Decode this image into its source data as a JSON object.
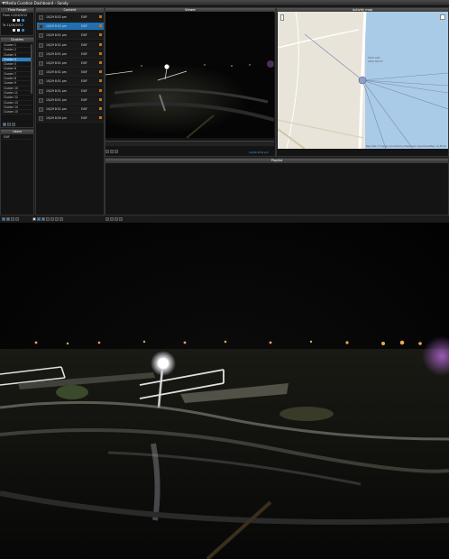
{
  "window": {
    "title": "Media Curation Dashboard - Sandy"
  },
  "time_range": {
    "title": "Time Range",
    "from_label": "From",
    "from_value": "11/04/2012",
    "to_label": "To",
    "to_value": "11/04/2012"
  },
  "clusters": {
    "title": "Clusters",
    "items": [
      "Cluster 1",
      "Cluster 2",
      "Cluster 3",
      "Cluster 4",
      "Cluster 5",
      "Cluster 6",
      "Cluster 7",
      "Cluster 8",
      "Cluster 9",
      "Cluster 10",
      "Cluster 11",
      "Cluster 12",
      "Cluster 13",
      "Cluster 14",
      "Cluster 15"
    ],
    "selected_index": 3
  },
  "users": {
    "title": "Users",
    "items": [
      "EXIF"
    ]
  },
  "content": {
    "title": "Content",
    "items": [
      {
        "time": "10/29 8:52 pm",
        "source": "EXIF"
      },
      {
        "time": "10/29 8:52 pm",
        "source": "EXIF"
      },
      {
        "time": "10/29 8:51 pm",
        "source": "EXIF"
      },
      {
        "time": "10/29 8:51 pm",
        "source": "EXIF"
      },
      {
        "time": "10/29 8:51 pm",
        "source": "EXIF"
      },
      {
        "time": "10/29 8:51 pm",
        "source": "EXIF"
      },
      {
        "time": "10/29 8:51 pm",
        "source": "EXIF"
      },
      {
        "time": "10/29 8:51 pm",
        "source": "EXIF"
      },
      {
        "time": "10/29 8:51 pm",
        "source": "EXIF"
      },
      {
        "time": "10/29 8:51 pm",
        "source": "EXIF"
      },
      {
        "time": "10/29 8:51 pm",
        "source": "EXIF"
      },
      {
        "time": "10/29 8:50 pm",
        "source": "EXIF"
      }
    ],
    "selected_index": 1
  },
  "viewer": {
    "title": "Viewer",
    "caption": "10/29 8:52 pm"
  },
  "activity_map": {
    "title": "Activity map",
    "places": [
      "HIGHLAND",
      "LONG BEACH"
    ],
    "attribution": "Map data © Imagery provided by MapQuest, OpenStreetMap, CC-BY-SA"
  },
  "playlist": {
    "title": "Playlist"
  },
  "colors": {
    "accent": "#2b82c9",
    "panel_bg": "#141414",
    "header": "#444444"
  }
}
